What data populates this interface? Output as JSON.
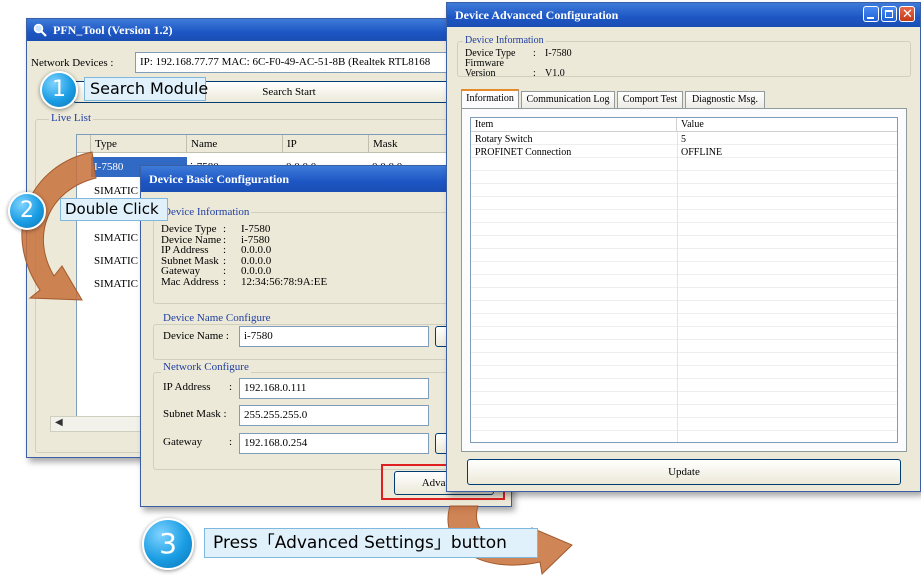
{
  "main_window": {
    "title": "PFN_Tool (Version 1.2)",
    "network_devices_label": "Network Devices :",
    "network_devices_value": "IP: 192.168.77.77  MAC: 6C-F0-49-AC-51-8B (Realtek RTL8168",
    "search_button": "Search Start",
    "live_list_label": "Live List",
    "columns": [
      "Type",
      "Name",
      "IP",
      "Mask"
    ],
    "rows": [
      {
        "type": "I-7580",
        "name": "i-7580",
        "ip": "0.0.0.0",
        "mask": "0.0.0.0"
      },
      {
        "type": "SIMATIC",
        "name": "",
        "ip": "",
        "mask": ""
      },
      {
        "type": "",
        "name": "",
        "ip": "",
        "mask": ""
      },
      {
        "type": "SIMATIC",
        "name": "",
        "ip": "",
        "mask": ""
      },
      {
        "type": "SIMATIC",
        "name": "",
        "ip": "",
        "mask": ""
      },
      {
        "type": "SIMATIC",
        "name": "",
        "ip": "",
        "mask": ""
      }
    ]
  },
  "basic_dialog": {
    "title": "Device Basic Configuration",
    "info_group": "Device Information",
    "info": [
      {
        "label": "Device Type",
        "value": "I-7580"
      },
      {
        "label": "Device Name",
        "value": "i-7580"
      },
      {
        "label": "IP Address",
        "value": "0.0.0.0"
      },
      {
        "label": "Subnet Mask",
        "value": "0.0.0.0"
      },
      {
        "label": "Gateway",
        "value": "0.0.0.0"
      },
      {
        "label": "Mac Address",
        "value": "12:34:56:78:9A:EE"
      }
    ],
    "name_group": "Device Name Configure",
    "device_name_label": "Device Name :",
    "device_name_value": "i-7580",
    "network_group": "Network Configure",
    "ip_label": "IP Address",
    "ip_value": "192.168.0.111",
    "mask_label": "Subnet Mask :",
    "mask_value": "255.255.255.0",
    "gateway_label": "Gateway",
    "gateway_value": "192.168.0.254",
    "colon": ":",
    "advanced_button": "Advanced"
  },
  "advanced_dialog": {
    "title": "Device Advanced Configuration",
    "info_group": "Device Information",
    "device_type_label": "Device Type",
    "device_type_value": "I-7580",
    "firmware_label": "Firmware Version",
    "firmware_value": "V1.0",
    "colon": ":",
    "tabs": [
      "Information",
      "Communication Log",
      "Comport Test",
      "Diagnostic Msg."
    ],
    "columns": [
      "Item",
      "Value"
    ],
    "rows": [
      {
        "item": "Rotary Switch",
        "value": "5"
      },
      {
        "item": "PROFINET Connection",
        "value": "OFFLINE"
      }
    ],
    "update_button": "Update"
  },
  "steps": [
    {
      "number": "1",
      "text": "Search Module"
    },
    {
      "number": "2",
      "text": "Double Click"
    },
    {
      "number": "3",
      "text": "Press「Advanced Settings」button"
    }
  ],
  "colors": {
    "titlebar": "#1d56c4",
    "step_circle": "#1a9de3",
    "callout_bg": "#e0f1fb",
    "arrow": "#c8703a",
    "highlight": "#e02020"
  }
}
